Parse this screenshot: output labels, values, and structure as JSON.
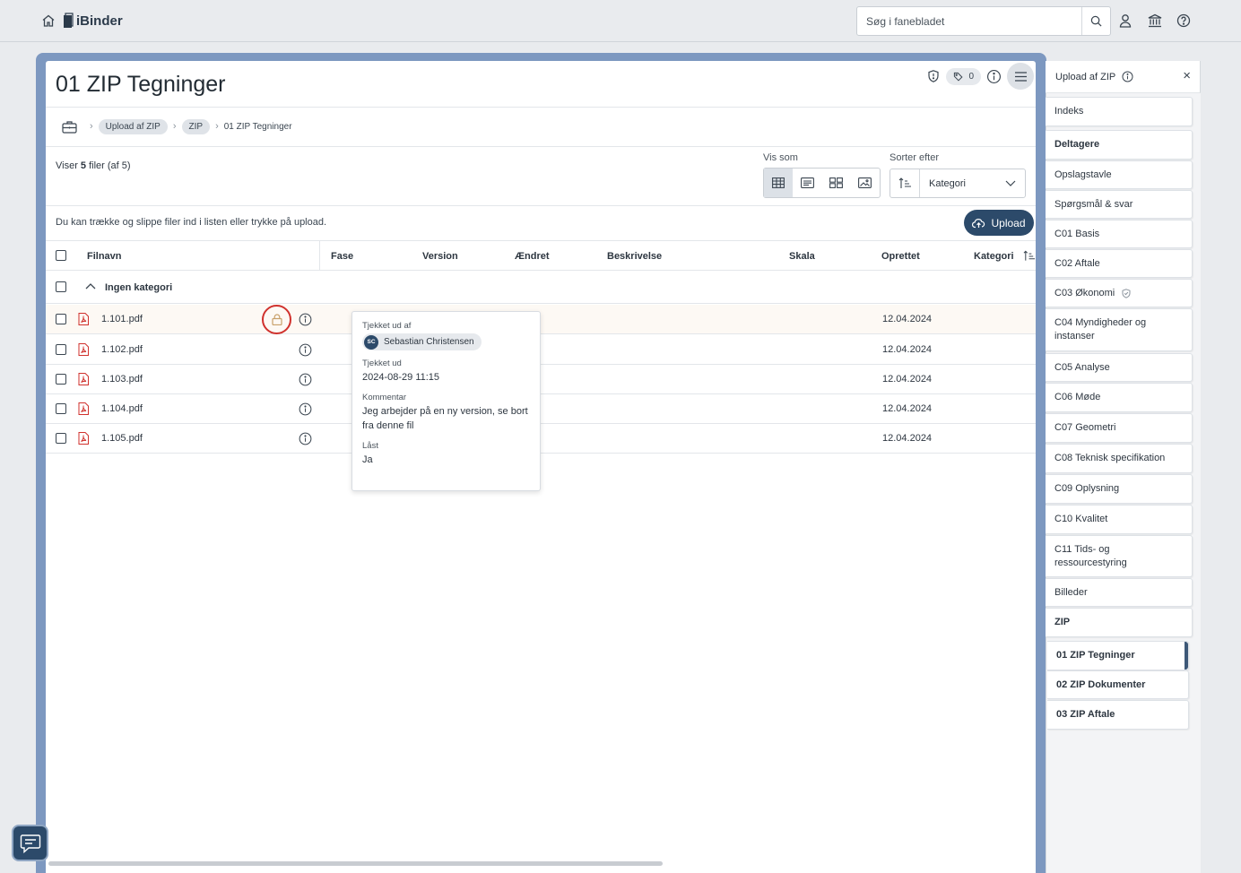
{
  "header": {
    "logo_text": "iBinder",
    "search_placeholder": "Søg i fanebladet"
  },
  "page": {
    "title": "01 ZIP Tegninger",
    "tag_count": "0",
    "breadcrumb": [
      "Upload af ZIP",
      "ZIP",
      "01 ZIP Tegninger"
    ],
    "count_prefix": "Viser ",
    "count_bold": "5",
    "count_suffix": " filer ",
    "count_total": "(af 5)",
    "view_label": "Vis som",
    "sort_label": "Sorter efter",
    "sort_value": "Kategori",
    "drop_hint": "Du kan trække og slippe filer ind i listen eller trykke på upload.",
    "upload_label": "Upload"
  },
  "table": {
    "columns": {
      "filename": "Filnavn",
      "phase": "Fase",
      "version": "Version",
      "changed": "Ændret",
      "description": "Beskrivelse",
      "scale": "Skala",
      "created": "Oprettet",
      "category": "Kategori"
    },
    "group_label": "Ingen kategori",
    "rows": [
      {
        "name": "1.101.pdf",
        "created": "12.04.2024"
      },
      {
        "name": "1.102.pdf",
        "created": "12.04.2024"
      },
      {
        "name": "1.103.pdf",
        "created": "12.04.2024"
      },
      {
        "name": "1.104.pdf",
        "created": "12.04.2024"
      },
      {
        "name": "1.105.pdf",
        "created": "12.04.2024"
      }
    ]
  },
  "popover": {
    "checked_out_by_label": "Tjekket ud af",
    "user_initials": "SC",
    "user_name": "Sebastian Christensen",
    "checked_out_label": "Tjekket ud",
    "checked_out_value": "2024-08-29 11:15",
    "comment_label": "Kommentar",
    "comment_value": "Jeg arbejder på en ny version, se bort fra denne fil",
    "locked_label": "Låst",
    "locked_value": "Ja"
  },
  "sidebar": {
    "title": "Upload af ZIP",
    "items": [
      "Indeks",
      "Deltagere",
      "Opslagstavle",
      "Spørgsmål & svar",
      "C01 Basis",
      "C02 Aftale",
      "C03 Økonomi",
      "C04 Myndigheder og instanser",
      "C05 Analyse",
      "C06 Møde",
      "C07 Geometri",
      "C08 Teknisk specifikation",
      "C09 Oplysning",
      "C10 Kvalitet",
      "C11 Tids- og ressourcestyring",
      "Billeder",
      "ZIP",
      "01 ZIP Tegninger",
      "02 ZIP Dokumenter",
      "03 ZIP Aftale"
    ]
  },
  "colors": {
    "accent": "#2c4a6a",
    "frame": "#7d98c0",
    "lock_highlight": "#d0312d",
    "pdf_red": "#d0312d"
  }
}
